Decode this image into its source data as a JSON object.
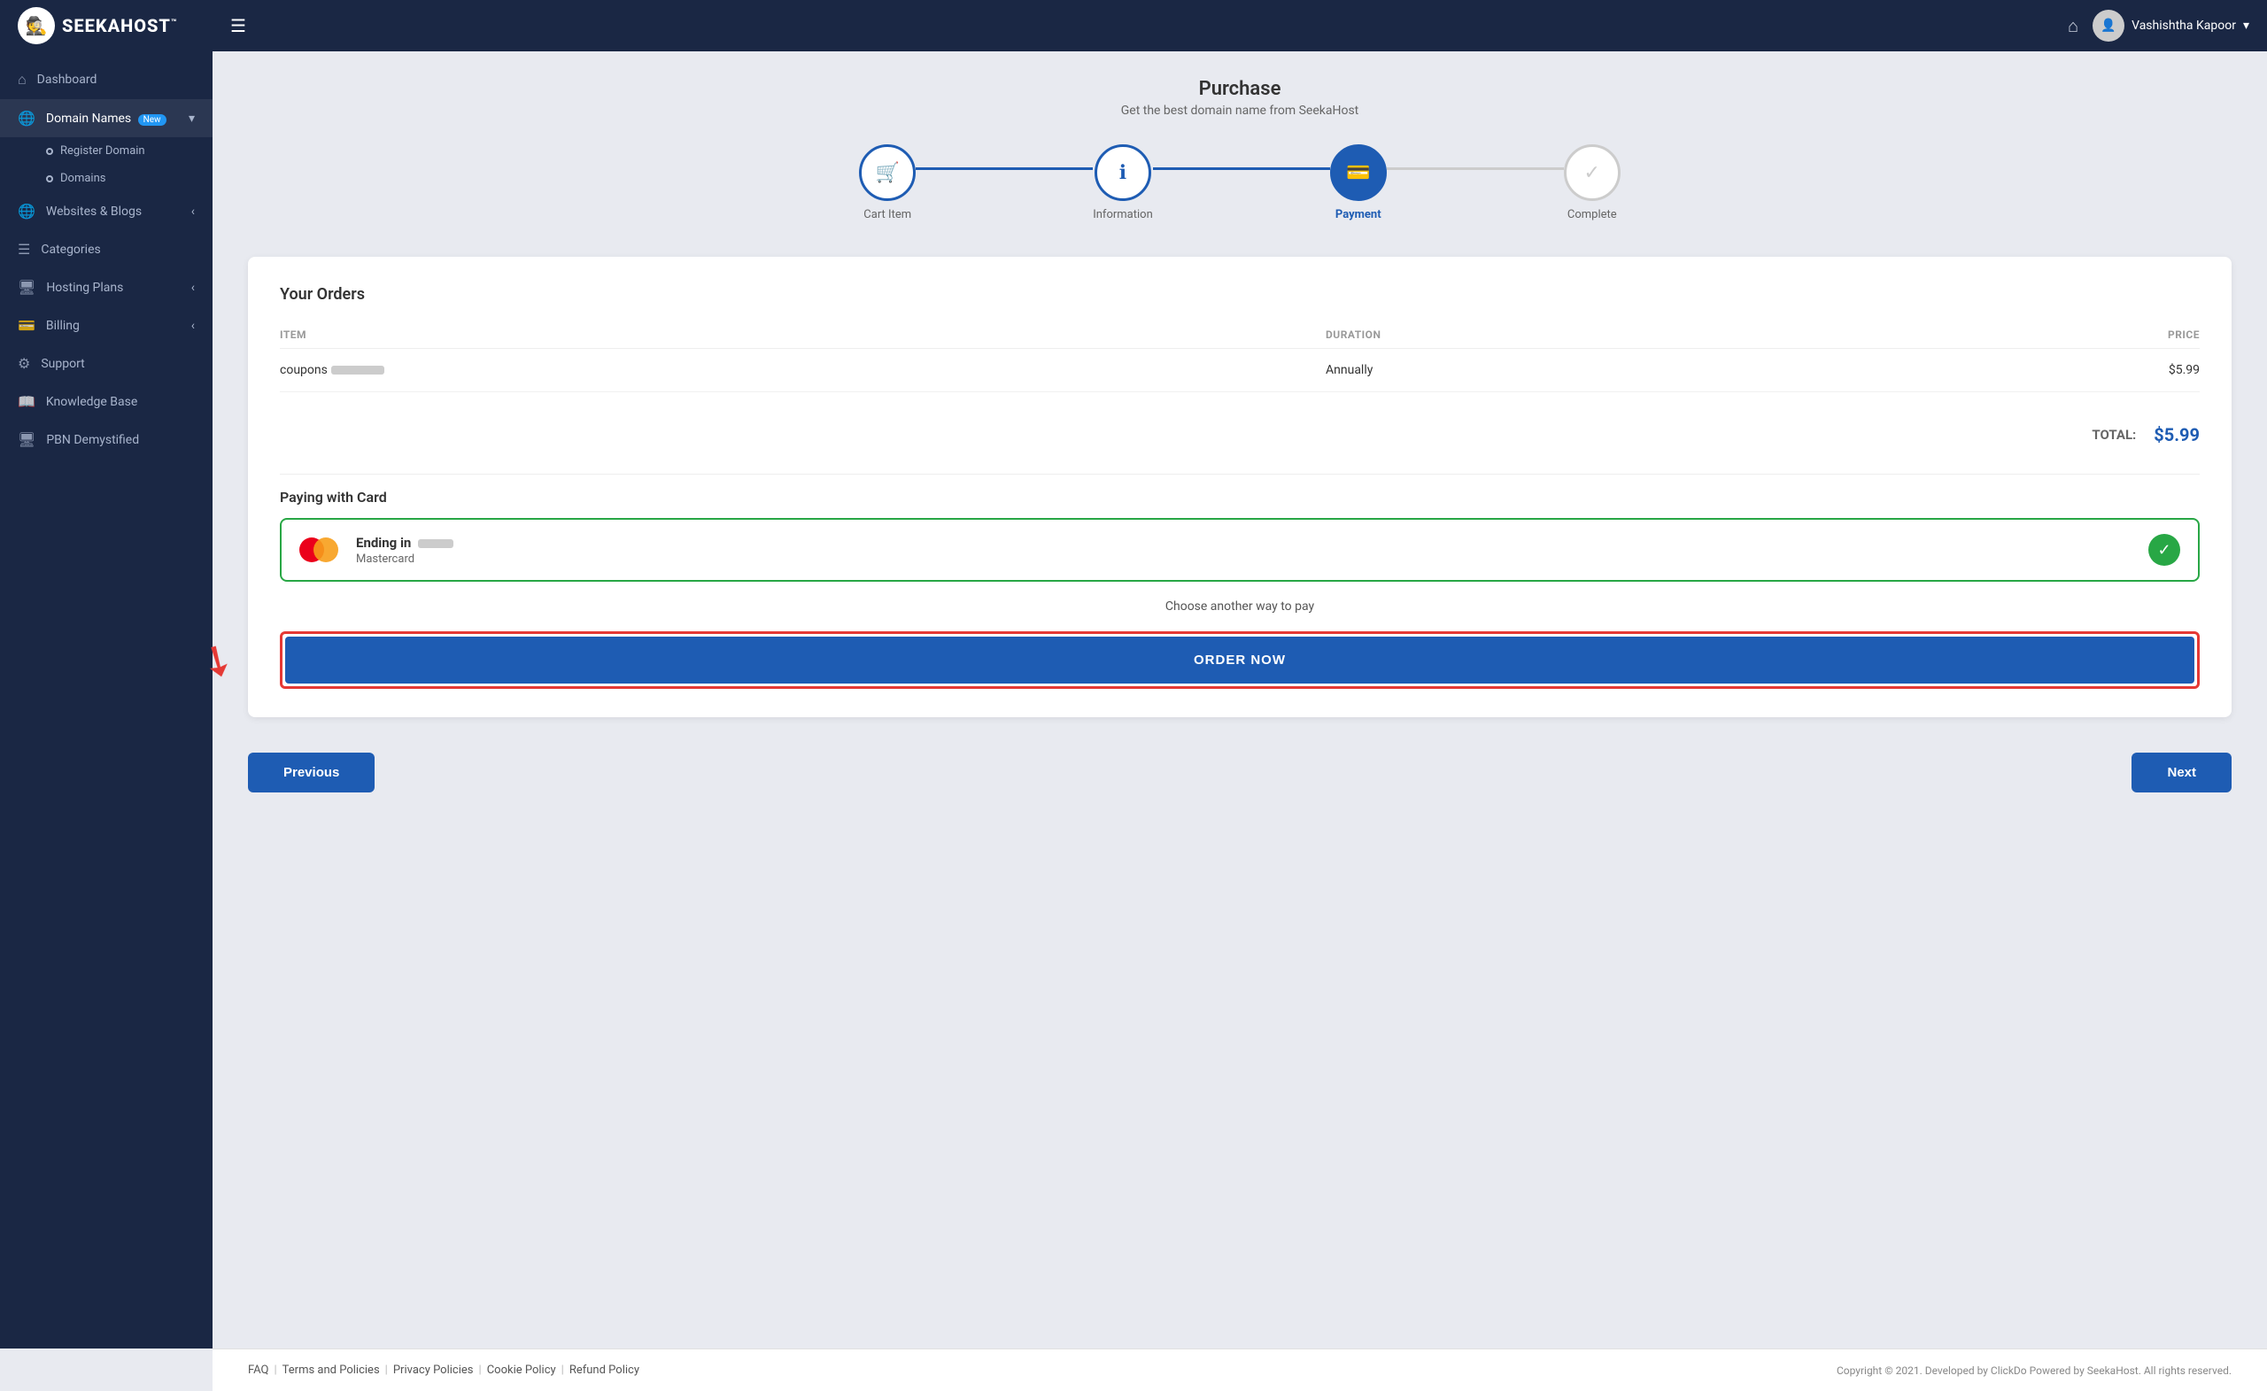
{
  "topbar": {
    "logo_text": "SEEKAHOST",
    "logo_tm": "™",
    "logo_emoji": "🕵️",
    "home_icon": "⌂",
    "menu_icon": "☰",
    "user_name": "Vashishtha Kapoor",
    "user_chevron": "▾"
  },
  "sidebar": {
    "items": [
      {
        "id": "dashboard",
        "icon": "⌂",
        "label": "Dashboard",
        "active": false
      },
      {
        "id": "domain-names",
        "icon": "🌐",
        "label": "Domain Names",
        "active": true,
        "badge": "New",
        "has_sub": true
      },
      {
        "id": "websites-blogs",
        "icon": "🌐",
        "label": "Websites & Blogs",
        "active": false,
        "has_chevron": true
      },
      {
        "id": "categories",
        "icon": "☰",
        "label": "Categories",
        "active": false
      },
      {
        "id": "hosting-plans",
        "icon": "🖥",
        "label": "Hosting Plans",
        "active": false,
        "has_chevron": true
      },
      {
        "id": "billing",
        "icon": "💳",
        "label": "Billing",
        "active": false,
        "has_chevron": true
      },
      {
        "id": "support",
        "icon": "⚙",
        "label": "Support",
        "active": false
      },
      {
        "id": "knowledge-base",
        "icon": "📖",
        "label": "Knowledge Base",
        "active": false
      },
      {
        "id": "pbn-demystified",
        "icon": "🖥",
        "label": "PBN Demystified",
        "active": false
      }
    ],
    "sub_items": [
      {
        "label": "Register Domain"
      },
      {
        "label": "Domains"
      }
    ]
  },
  "page": {
    "title": "Purchase",
    "subtitle": "Get the best domain name from SeekaHost"
  },
  "stepper": {
    "steps": [
      {
        "id": "cart",
        "icon": "🛒",
        "label": "Cart Item",
        "state": "done"
      },
      {
        "id": "information",
        "icon": "ℹ",
        "label": "Information",
        "state": "done"
      },
      {
        "id": "payment",
        "icon": "💳",
        "label": "Payment",
        "state": "active"
      },
      {
        "id": "complete",
        "icon": "✓",
        "label": "Complete",
        "state": "inactive"
      }
    ]
  },
  "orders": {
    "title": "Your Orders",
    "columns": {
      "item": "ITEM",
      "duration": "DURATION",
      "price": "PRICE"
    },
    "rows": [
      {
        "item_prefix": "coupons",
        "duration": "Annually",
        "price": "$5.99"
      }
    ],
    "total_label": "TOTAL:",
    "total_amount": "$5.99"
  },
  "payment": {
    "title": "Paying with Card",
    "card_ending_label": "Ending in",
    "card_type": "Mastercard",
    "choose_other": "Choose another way to pay"
  },
  "order_button": {
    "label": "ORDER NOW"
  },
  "navigation": {
    "previous": "Previous",
    "next": "Next"
  },
  "footer": {
    "links": [
      "FAQ",
      "Terms and Policies",
      "Privacy Policies",
      "Cookie Policy",
      "Refund Policy"
    ],
    "copyright": "Copyright © 2021. Developed by ClickDo Powered by SeekaHost. All rights reserved."
  }
}
